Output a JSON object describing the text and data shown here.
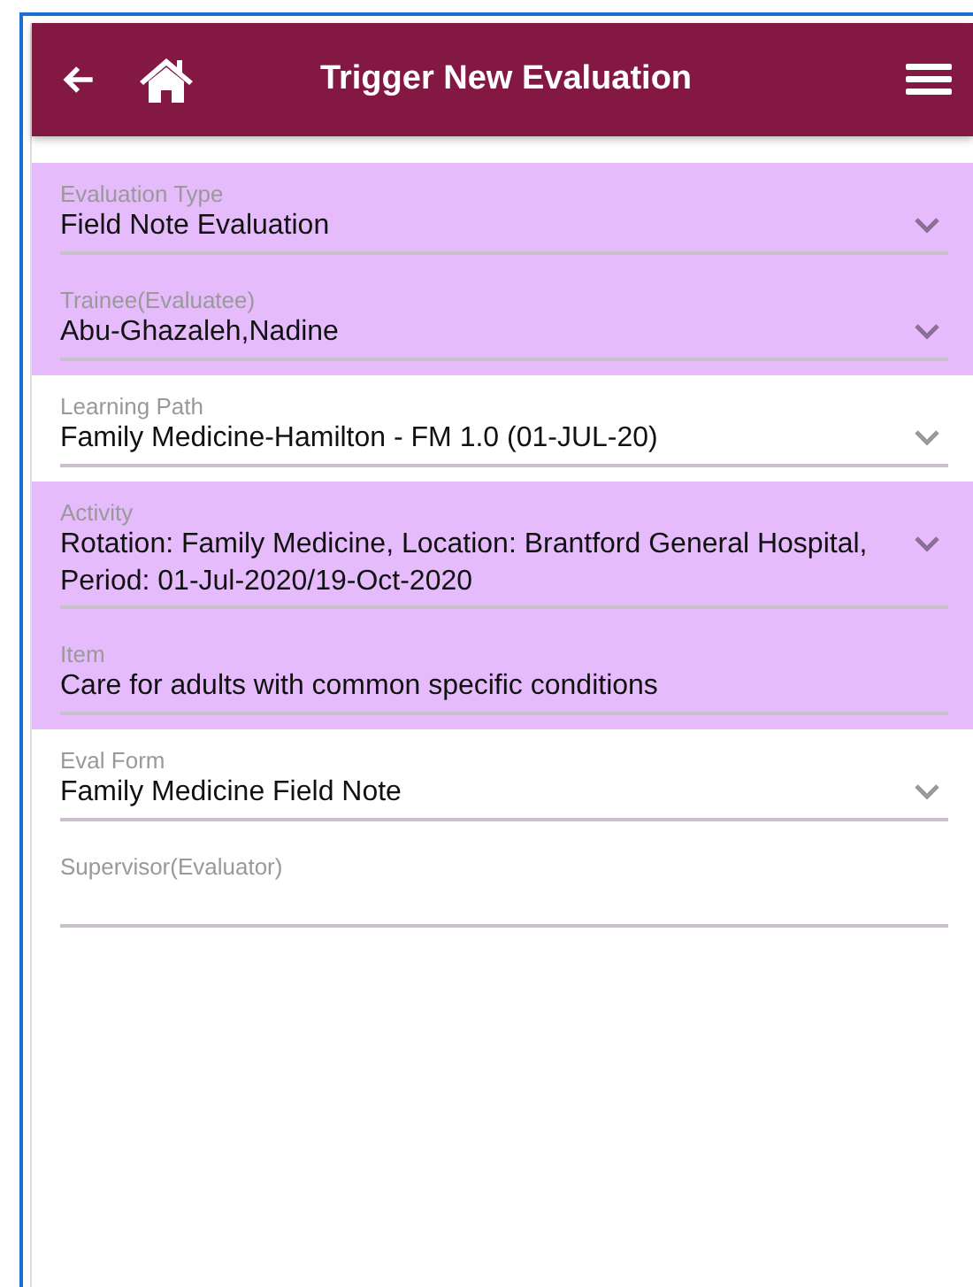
{
  "header": {
    "title": "Trigger New Evaluation"
  },
  "fields": [
    {
      "label": "Evaluation Type",
      "value": "Field Note Evaluation",
      "dropdown": true,
      "highlighted": true
    },
    {
      "label": "Trainee(Evaluatee)",
      "value": "Abu-Ghazaleh,Nadine",
      "dropdown": true,
      "highlighted": true
    },
    {
      "label": "Learning Path",
      "value": "Family Medicine-Hamilton - FM 1.0 (01-JUL-20)",
      "dropdown": true,
      "highlighted": false
    },
    {
      "label": "Activity",
      "value": "Rotation: Family Medicine, Location: Brantford General Hospital, Period: 01-Jul-2020/19-Oct-2020",
      "dropdown": true,
      "highlighted": true
    },
    {
      "label": "Item",
      "value": "Care for adults with common specific conditions",
      "dropdown": false,
      "highlighted": true
    },
    {
      "label": "Eval Form",
      "value": "Family Medicine Field Note",
      "dropdown": true,
      "highlighted": false
    },
    {
      "label": "Supervisor(Evaluator)",
      "dropdown": false,
      "highlighted": false
    }
  ]
}
